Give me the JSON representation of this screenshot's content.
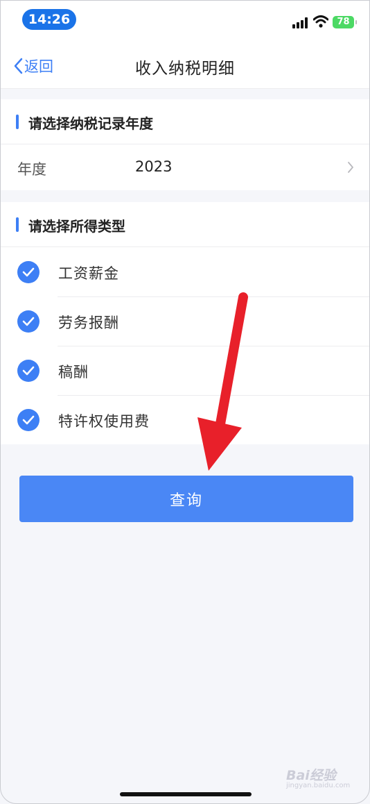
{
  "status_bar": {
    "time": "14:26",
    "battery": "78",
    "icons": [
      "signal-icon",
      "wifi-icon",
      "battery-icon"
    ]
  },
  "nav": {
    "back_label": "返回",
    "title": "收入纳税明细"
  },
  "year_section": {
    "title": "请选择纳税记录年度",
    "label": "年度",
    "value": "2023"
  },
  "income_section": {
    "title": "请选择所得类型",
    "items": [
      {
        "label": "工资薪金",
        "checked": true
      },
      {
        "label": "劳务报酬",
        "checked": true
      },
      {
        "label": "稿酬",
        "checked": true
      },
      {
        "label": "特许权使用费",
        "checked": true
      }
    ]
  },
  "query_button": "查询",
  "watermark": {
    "brand": "Bai经验",
    "url": "jingyan.baidu.com"
  },
  "colors": {
    "accent": "#3d7ff5",
    "button": "#4a87f5",
    "annotation_arrow": "#e8202a",
    "background": "#f5f6fa"
  }
}
